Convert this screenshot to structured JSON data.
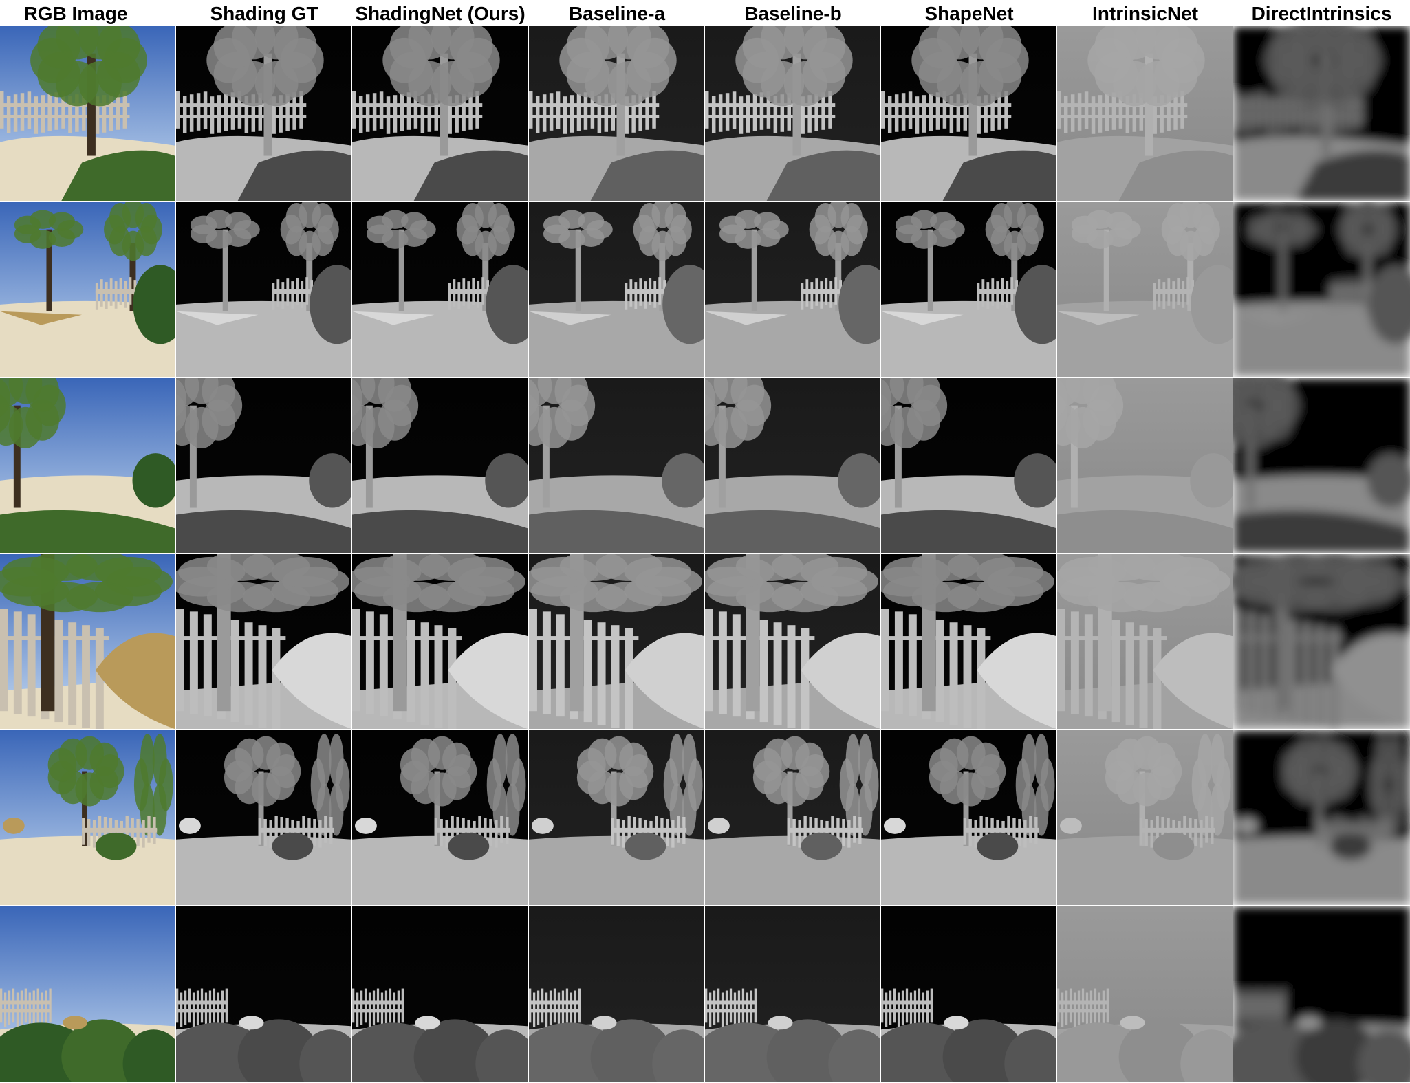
{
  "figure": {
    "columns": [
      {
        "id": "rgb",
        "label": "RGB Image"
      },
      {
        "id": "gt",
        "label": "Shading GT"
      },
      {
        "id": "ours",
        "label": "ShadingNet (Ours)"
      },
      {
        "id": "base_a",
        "label": "Baseline-a"
      },
      {
        "id": "base_b",
        "label": "Baseline-b"
      },
      {
        "id": "shapenet",
        "label": "ShapeNet"
      },
      {
        "id": "intrinsicnet",
        "label": "IntrinsicNet"
      },
      {
        "id": "directintrinsics",
        "label": "DirectIntrinsics"
      }
    ],
    "rows": [
      {
        "id": "scene-1",
        "content": "fence-tree-left"
      },
      {
        "id": "scene-2",
        "content": "two-trees-bush"
      },
      {
        "id": "scene-3",
        "content": "tree-left-bush"
      },
      {
        "id": "scene-4",
        "content": "fence-rock-closeup"
      },
      {
        "id": "scene-5",
        "content": "tree-distant-fence"
      },
      {
        "id": "scene-6",
        "content": "low-fence-shrubs"
      }
    ],
    "colors": {
      "sky_blue": "#3a66b8",
      "sky_light": "#c8dcf2",
      "foliage_green": "#3f6a2a",
      "ground_sand": "#e6dcc2",
      "shading_dark": "#050505",
      "intrinsicnet_grey": "#8c8c8c"
    }
  }
}
